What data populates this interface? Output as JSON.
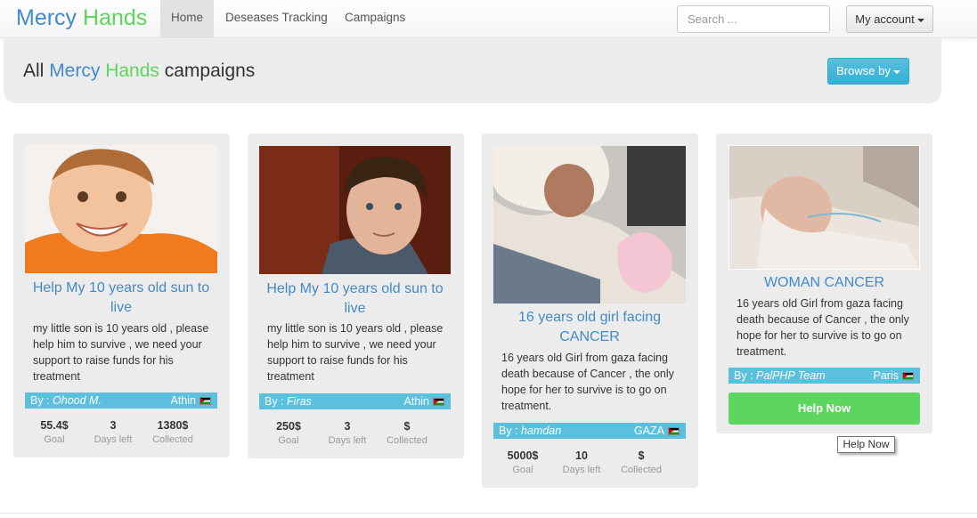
{
  "navbar": {
    "brand_part1": "Mercy",
    "brand_part2": "Hands",
    "items": [
      {
        "label": "Home",
        "active": true
      },
      {
        "label": "Deseases Tracking"
      },
      {
        "label": "Campaigns"
      }
    ],
    "search_placeholder": "Search ...",
    "account_label": "My account"
  },
  "header": {
    "title_prefix": "All",
    "title_brand1": "Mercy",
    "title_brand2": "Hands",
    "title_suffix": "campaigns",
    "browse_label": "Browse by"
  },
  "campaigns": [
    {
      "title": "Help My 10 years old sun to live",
      "description": "my little son is 10 years old , please help him to survive , we need your support to raise funds for his treatment",
      "by_prefix": "By :",
      "author": "Ohood M.",
      "location": "Athin",
      "goal": "55.4$",
      "goal_label": "Goal",
      "days": "3",
      "days_label": "Days left",
      "collected": "1380$",
      "collected_label": "Collected"
    },
    {
      "title": "Help My 10 years old sun to live",
      "description": "my little son is 10 years old , please help him to survive , we need your support to raise funds for his treatment",
      "by_prefix": "By :",
      "author": "Firas",
      "location": "Athin",
      "goal": "250$",
      "goal_label": "Goal",
      "days": "3",
      "days_label": "Days left",
      "collected": "$",
      "collected_label": "Collected"
    },
    {
      "title": "16 years old girl facing CANCER",
      "description": "16 years old Girl from gaza facing death because of Cancer , the only hope for her to survive is to go on treatment.",
      "by_prefix": "By :",
      "author": "hamdan",
      "location": "GAZA",
      "goal": "5000$",
      "goal_label": "Goal",
      "days": "10",
      "days_label": "Days left",
      "collected": "$",
      "collected_label": "Collected"
    },
    {
      "title": "WOMAN CANCER",
      "description": "16 years old Girl from gaza facing death because of Cancer , the only hope for her to survive is to go on treatment.",
      "by_prefix": "By :",
      "author": "PalPHP Team",
      "location": "Paris",
      "help_label": "Help Now"
    }
  ],
  "tooltip": "Help Now",
  "colors": {
    "brand_blue": "#428bca",
    "brand_green": "#5cd65c",
    "info": "#5bc0de",
    "panel": "#ececec"
  }
}
